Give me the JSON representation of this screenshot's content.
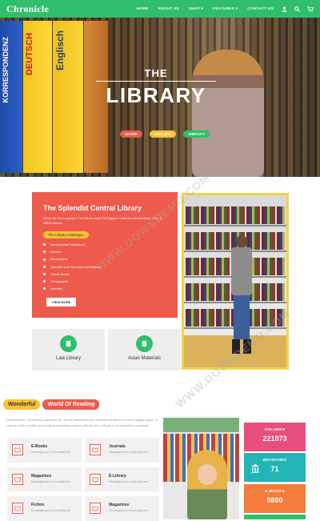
{
  "nav": {
    "logo": "Chronicle",
    "items": [
      "HOME",
      "ABOUT US",
      "SHOP ▾",
      "FEATURES ▾",
      "CONTACT US"
    ],
    "icons": [
      "user-icon",
      "search-icon",
      "cart-icon"
    ]
  },
  "hero": {
    "title_small": "THE",
    "title_large": "LIBRARY",
    "buttons": [
      {
        "label": "SHARE",
        "color": "#ee5b4c"
      },
      {
        "label": "EXPLORE",
        "color": "#f7c233"
      },
      {
        "label": "SIMPLIFY",
        "color": "#2fbf6a"
      }
    ],
    "book_titles": [
      "KORRESPONDENZ",
      "DEUTSCH",
      "Englisch"
    ]
  },
  "intro": {
    "title": "The Splendid Central Library",
    "desc": "Given as The Largest In The Whole And The Biggest Collection Media More Than 3 Million Books",
    "catalogue_label": "The Library Catalogue",
    "categories": [
      "International Collections",
      "Ebooks",
      "Manuscripts",
      "Scientific And Technical Information",
      "Comic Books",
      "Cartography",
      "Journals"
    ],
    "view_more": "VIEW MORE"
  },
  "features": [
    {
      "label": "Law Library"
    },
    {
      "label": "Asian Materials"
    }
  ],
  "tabs": {
    "tab1": "Wonderful",
    "tab2": "World Of Reading"
  },
  "lorem": "Dolor sit amet, consectetur adipiscing elit, sed do eiusmod tempor incididunt ut labore et dolore magna aliqua. Ut enim ad minim veniam, quis nostrud exercitation ullamco laboris nisi ut aliquip ex ea commodo consequat.",
  "resources": [
    {
      "title": "E-Books",
      "sub": "Readingbook is a donothly text"
    },
    {
      "title": "Journals",
      "sub": "Readingbook is a donothly text"
    },
    {
      "title": "Magazines",
      "sub": "Readingbook is a donothly text"
    },
    {
      "title": "E-Library",
      "sub": "Readingbook is a donothly text"
    },
    {
      "title": "Fiction",
      "sub": "Readingbook is a donothly text"
    },
    {
      "title": "Magazines",
      "sub": "Readingbook is a donothly text"
    }
  ],
  "stats": [
    {
      "label": "VOLUMES",
      "value": "221073",
      "color": "#e94f7c"
    },
    {
      "label": "BRANCHES",
      "value": "71",
      "color": "#23b5b5"
    },
    {
      "label": "E-BOOKS",
      "value": "9800",
      "color": "#f57c3a"
    },
    {
      "label": "",
      "value": "",
      "color": "#2fbf6a"
    }
  ],
  "watermark": "WWW.DOWNDEMO.COM",
  "colors": {
    "primary": "#2fbf6a",
    "accent_red": "#ee5b4c",
    "accent_yellow": "#f7c233"
  }
}
